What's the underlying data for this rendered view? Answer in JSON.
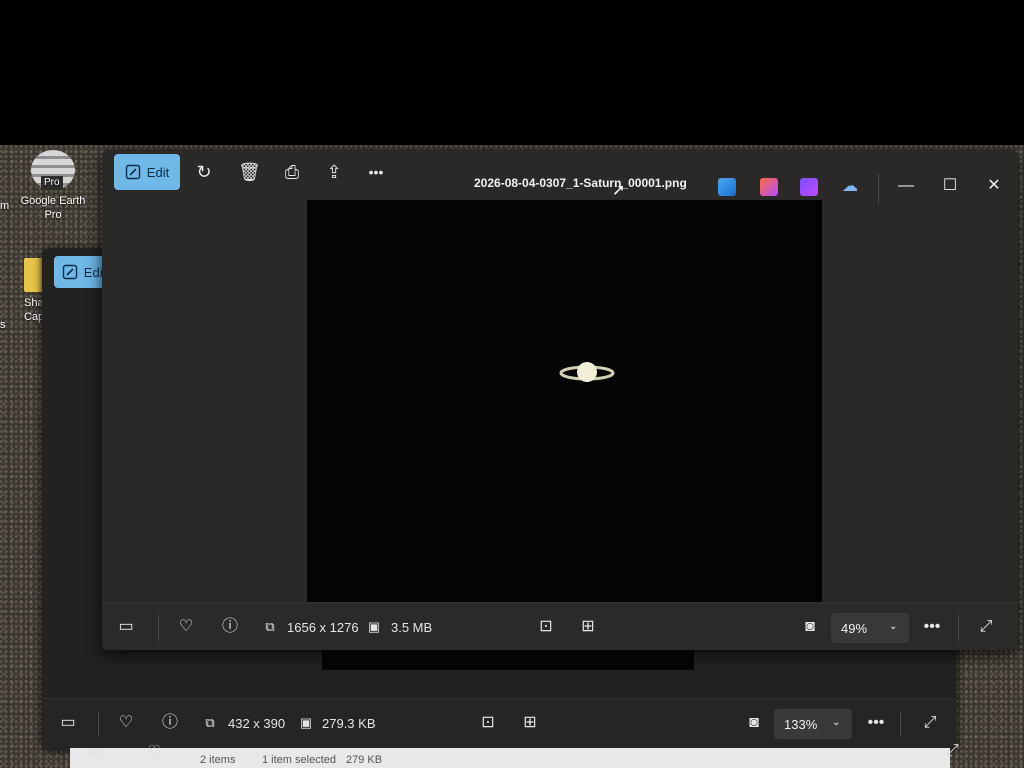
{
  "desktop": {
    "icons": [
      {
        "name": "Google Earth Pro",
        "line1": "Google Earth",
        "line2": "Pro",
        "badge": "Pro"
      },
      {
        "name": "Shar Cap",
        "line1": "Shar",
        "line2": "Cap"
      }
    ],
    "left_edge_labels": [
      "m",
      "s"
    ]
  },
  "front_window": {
    "edit_label": "Edit",
    "title": "2026-08-04-0307_1-Saturn_00001.png",
    "dimensions": "1656 x 1276",
    "file_size": "3.5 MB",
    "zoom": "49%",
    "toolbar_icons": [
      "rotate-icon",
      "delete-icon",
      "print-icon",
      "share-icon",
      "more-icon"
    ],
    "app_icons": [
      "photo-app-icon",
      "designer-app-icon",
      "clipchamp-icon",
      "onedrive-icon"
    ],
    "colors": {
      "edit_accent": "#6fb8e8",
      "background": "#2a2928"
    }
  },
  "back_window": {
    "edit_label": "Edit",
    "dimensions": "432 x 390",
    "file_size": "279.3 KB",
    "zoom": "133%"
  },
  "explorer_status": {
    "items": "2 items",
    "selected": "1 item selected",
    "size": "279 KB"
  }
}
